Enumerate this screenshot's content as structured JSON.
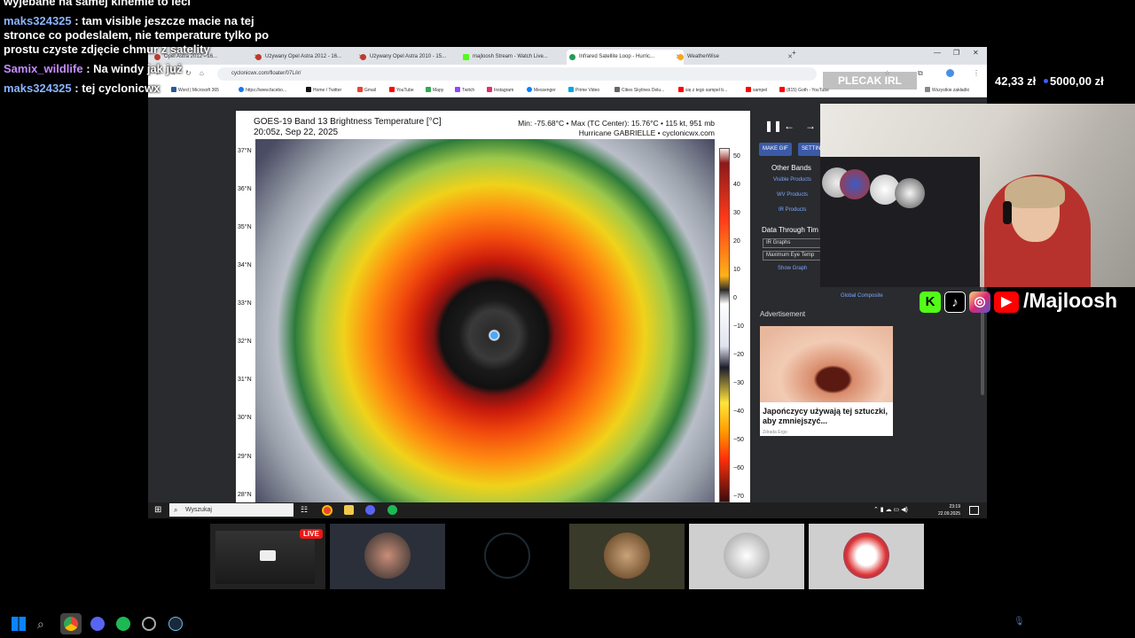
{
  "chat": {
    "messages": [
      {
        "user": "",
        "text": "wyjebane na samej kinemie to leci"
      },
      {
        "user": "maks324325",
        "text": "tam visible jeszcze macie na tej stronce co podeslalem, nie temperature tylko po prostu czyste zdjęcie chmur z satelity"
      },
      {
        "user": "Samix_wildlife",
        "text": "Na windy jak już"
      },
      {
        "user": "maks324325",
        "text": "tej cyclonicwx"
      }
    ]
  },
  "browser": {
    "tabs": [
      {
        "label": "Opel Astra 2012 - 16...",
        "color": "#c0392b"
      },
      {
        "label": "Używany Opel Astra 2012 - 16...",
        "color": "#c0392b"
      },
      {
        "label": "Używany Opel Astra 2010 - 15...",
        "color": "#c0392b"
      },
      {
        "label": "majloosh Stream - Watch Live...",
        "color": "#53fc18"
      },
      {
        "label": "Infrared Satellite Loop - Hurric...",
        "color": "#1f9d55"
      },
      {
        "label": "WeatherWise",
        "color": "#f5a623"
      }
    ],
    "new_tab": "+",
    "url": "cyclonicwx.com/floater/07L/ir/",
    "bookmarks": [
      {
        "label": "Word | Microsoft 365",
        "color": "#2b579a"
      },
      {
        "label": "https://www.facebo...",
        "color": "#1877f2"
      },
      {
        "label": "Home / Twitter",
        "color": "#111"
      },
      {
        "label": "Gmail",
        "color": "#ea4335"
      },
      {
        "label": "YouTube",
        "color": "#ff0000"
      },
      {
        "label": "Mapy",
        "color": "#34a853"
      },
      {
        "label": "Twitch",
        "color": "#9146ff"
      },
      {
        "label": "Instagram",
        "color": "#e1306c"
      },
      {
        "label": "Messenger",
        "color": "#0084ff"
      },
      {
        "label": "Prime Video",
        "color": "#00a8e1"
      },
      {
        "label": "Cities Skylines Delu...",
        "color": "#666"
      },
      {
        "label": "się z tego sampel b...",
        "color": "#ff0000"
      },
      {
        "label": "sampel",
        "color": "#ff0000"
      },
      {
        "label": "(815) Goth - YouTube",
        "color": "#ff0000"
      }
    ],
    "all_bookmarks": "Wszystkie zakładki"
  },
  "satellite": {
    "title": "GOES-19 Band 13 Brightness Temperature [°C]",
    "time": "20:05z, Sep 22, 2025",
    "stats": "Min: -75.68°C • Max (TC Center): 15.76°C • 115 kt, 951 mb",
    "storm": "Hurricane GABRIELLE • cyclonicwx.com",
    "latitudes": [
      "37°N",
      "36°N",
      "35°N",
      "34°N",
      "33°N",
      "32°N",
      "31°N",
      "30°N",
      "29°N",
      "28°N"
    ],
    "colorbar_ticks": [
      "50",
      "40",
      "30",
      "20",
      "10",
      "0",
      "−10",
      "−20",
      "−30",
      "−40",
      "−50",
      "−60",
      "−70"
    ]
  },
  "panel": {
    "make_gif": "MAKE GIF",
    "settings": "SETTIN",
    "other_bands": "Other Bands",
    "visible": "Visible Products",
    "wv": "WV Products",
    "ir": "IR Products",
    "data_through": "Data Through Tim",
    "ir_graphs": "IR Graphs",
    "max_eye": "Maximum Eye Temp",
    "show_graph": "Show Graph",
    "global": "Global Composite",
    "advertisement": "Advertisement",
    "ad_text": "Japończycy używają tej sztuczki, aby zmniejszyć...",
    "ad_source": "Zdrada Ergo"
  },
  "taskbar_inner": {
    "search": "Wyszukaj",
    "time": "23:19",
    "date": "22.09.2025"
  },
  "overlay": {
    "plecak": "PLECAK IRL",
    "amount1": "42,33 zł",
    "amount2": "5000,00 zł",
    "handle": "/Majloosh"
  },
  "participants": {
    "live": "LIVE"
  }
}
